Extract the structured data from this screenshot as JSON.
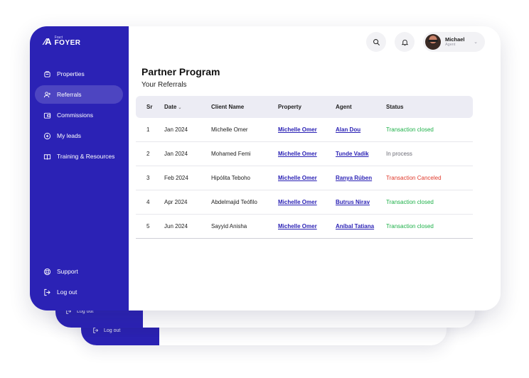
{
  "brand": {
    "mark": "⁄A",
    "small": "Fract",
    "name": "FOYER"
  },
  "sidebar": {
    "items": [
      {
        "label": "Properties",
        "icon": "building-icon"
      },
      {
        "label": "Referrals",
        "icon": "user-plus-icon",
        "active": true
      },
      {
        "label": "Commissions",
        "icon": "wallet-icon"
      },
      {
        "label": "My leads",
        "icon": "plus-circle-icon"
      },
      {
        "label": "Training & Resources",
        "icon": "book-icon"
      }
    ],
    "bottom": [
      {
        "label": "Support",
        "icon": "lifebuoy-icon"
      },
      {
        "label": "Log out",
        "icon": "logout-icon"
      }
    ]
  },
  "ghost": {
    "logout_1": "Log out",
    "logout_2": "Log out"
  },
  "header": {
    "user_name": "Michael",
    "user_role": "Agent"
  },
  "page": {
    "title": "Partner Program",
    "subtitle": "Your Referrals"
  },
  "table": {
    "columns": [
      "Sr",
      "Date",
      "Client Name",
      "Property",
      "Agent",
      "Status"
    ],
    "rows": [
      {
        "sr": "1",
        "date": "Jan 2024",
        "client": "Michelle Omer",
        "property": "Michelle Omer",
        "agent": "Alan Dou",
        "status": "Transaction closed"
      },
      {
        "sr": "2",
        "date": "Jan 2024",
        "client": "Mohamed Femi",
        "property": "Michelle Omer",
        "agent": "Tunde Vadik",
        "status": "In process"
      },
      {
        "sr": "3",
        "date": "Feb 2024",
        "client": "Hipólita Teboho",
        "property": "Michelle Omer",
        "agent": "Ranya Rúben",
        "status": "Transaction Canceled"
      },
      {
        "sr": "4",
        "date": "Apr 2024",
        "client": "Abdelmajid Teófilo",
        "property": "Michelle Omer",
        "agent": "Butrus Nirav",
        "status": "Transaction closed"
      },
      {
        "sr": "5",
        "date": "Jun 2024",
        "client": "Sayyid Anisha",
        "property": "Michelle Omer",
        "agent": "Aníbal Tatiana",
        "status": "Transaction closed"
      }
    ]
  },
  "colors": {
    "sidebar": "#2b22b5",
    "closed": "#1fb14a",
    "canceled": "#e0392b",
    "in_process": "#6a6a74",
    "link": "#2b22b5"
  }
}
